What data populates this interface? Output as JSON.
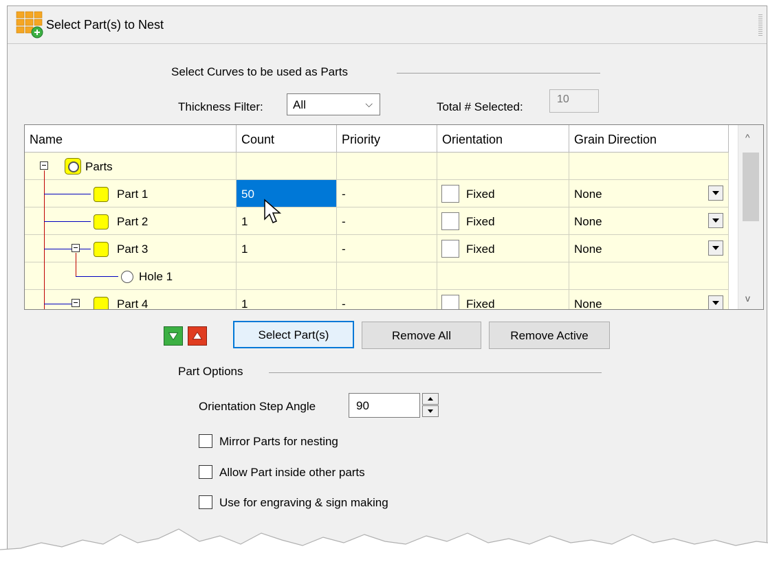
{
  "window": {
    "title": "Select Part(s) to Nest"
  },
  "curves_section": {
    "label": "Select Curves to be used as Parts"
  },
  "thickness_filter": {
    "label": "Thickness Filter:",
    "value": "All"
  },
  "total_selected": {
    "label": "Total # Selected:",
    "value": "10"
  },
  "grid": {
    "columns": [
      "Name",
      "Count",
      "Priority",
      "Orientation",
      "Grain Direction"
    ],
    "root": {
      "label": "Parts"
    },
    "rows": [
      {
        "name": "Part 1",
        "count": "50",
        "priority": "-",
        "orientation": "Fixed",
        "grain": "None"
      },
      {
        "name": "Part 2",
        "count": "1",
        "priority": "-",
        "orientation": "Fixed",
        "grain": "None"
      },
      {
        "name": "Part 3",
        "count": "1",
        "priority": "-",
        "orientation": "Fixed",
        "grain": "None"
      },
      {
        "name": "Hole 1"
      },
      {
        "name": "Part 4",
        "count": "1",
        "priority": "-",
        "orientation": "Fixed",
        "grain": "None"
      }
    ]
  },
  "buttons": {
    "select_parts": "Select Part(s)",
    "remove_all": "Remove All",
    "remove_active": "Remove Active"
  },
  "part_options": {
    "label": "Part Options",
    "step_angle_label": "Orientation Step Angle",
    "step_angle_value": "90",
    "mirror_label": "Mirror Parts for nesting",
    "allow_inside_label": "Allow Part inside other parts",
    "engraving_label": "Use for engraving & sign making"
  },
  "colors": {
    "grid_row_bg": "#ffffe1",
    "selection_blue": "#0078d7",
    "tree_line_red": "#c00000",
    "tree_line_blue": "#0000c0",
    "move_down_green": "#3cb043",
    "move_up_red": "#e03c20"
  }
}
